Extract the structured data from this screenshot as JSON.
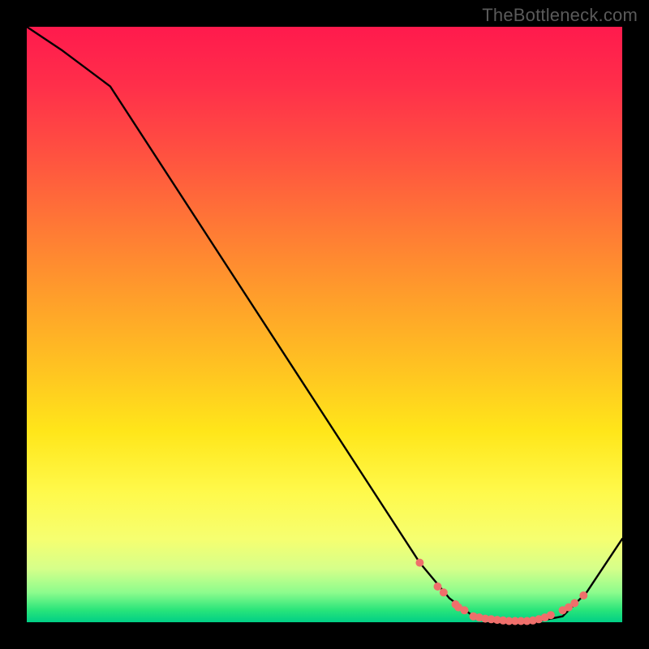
{
  "watermark": "TheBottleneck.com",
  "colors": {
    "frame_bg": "#000000",
    "curve_stroke": "#000000",
    "marker_fill": "#ef6f6b",
    "gradient_top": "#ff1a4d",
    "gradient_bottom": "#00cf86"
  },
  "chart_data": {
    "type": "line",
    "title": "",
    "xlabel": "",
    "ylabel": "",
    "xlim": [
      0,
      100
    ],
    "ylim": [
      0,
      100
    ],
    "x": [
      0,
      6,
      14,
      66,
      71,
      75,
      80,
      85,
      90,
      94,
      100
    ],
    "values": [
      100,
      96,
      90,
      10,
      4,
      1,
      0,
      0,
      1,
      5,
      14
    ],
    "markers": {
      "x": [
        66,
        69,
        70,
        72,
        72.5,
        73.5,
        75,
        76,
        77,
        78,
        79,
        80,
        81,
        82,
        83,
        84,
        85,
        86,
        87,
        88,
        90,
        91,
        92,
        93.5
      ],
      "y": [
        10,
        6,
        5,
        3,
        2.5,
        2,
        1,
        0.8,
        0.6,
        0.5,
        0.4,
        0.3,
        0.2,
        0.2,
        0.2,
        0.2,
        0.3,
        0.5,
        0.8,
        1.2,
        2,
        2.5,
        3.2,
        4.5
      ]
    },
    "note": "No axes, ticks, or legend visible. Values are bottleneck-percentage style: high at left, dip to ~0 near x≈80–85, slight rise at right."
  }
}
